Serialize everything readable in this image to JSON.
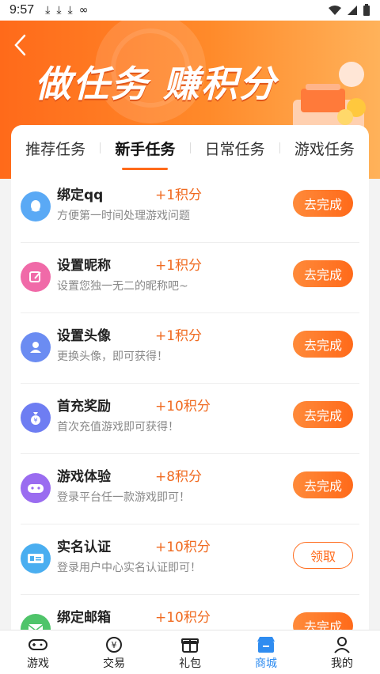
{
  "status_bar": {
    "time": "9:57"
  },
  "banner": {
    "title": "做任务 赚积分"
  },
  "tabs": [
    {
      "label": "推荐任务"
    },
    {
      "label": "新手任务"
    },
    {
      "label": "日常任务"
    },
    {
      "label": "游戏任务"
    }
  ],
  "active_tab": "新手任务",
  "tasks": [
    {
      "name": "绑定qq",
      "points": "+1积分",
      "desc": "方便第一时间处理游戏问题",
      "action": "去完成",
      "icon": "qq-icon",
      "color": "#5aa9f5"
    },
    {
      "name": "设置昵称",
      "points": "+1积分",
      "desc": "设置您独一无二的昵称吧~",
      "action": "去完成",
      "icon": "edit-icon",
      "color": "#f06aa8"
    },
    {
      "name": "设置头像",
      "points": "+1积分",
      "desc": "更换头像，即可获得！",
      "action": "去完成",
      "icon": "avatar-icon",
      "color": "#6b8cf2"
    },
    {
      "name": "首充奖励",
      "points": "+10积分",
      "desc": "首次充值游戏即可获得！",
      "action": "去完成",
      "icon": "money-bag-icon",
      "color": "#6e7df2"
    },
    {
      "name": "游戏体验",
      "points": "+8积分",
      "desc": "登录平台任一款游戏即可！",
      "action": "去完成",
      "icon": "gamepad-icon",
      "color": "#9a6cf0"
    },
    {
      "name": "实名认证",
      "points": "+10积分",
      "desc": "登录用户中心实名认证即可！",
      "action": "领取",
      "icon": "id-card-icon",
      "color": "#4aaef0"
    },
    {
      "name": "绑定邮箱",
      "points": "+10积分",
      "desc": "",
      "action": "去完成",
      "icon": "mail-icon",
      "color": "#4fc46a"
    }
  ],
  "bottom_nav": [
    {
      "label": "游戏",
      "icon": "gamepad-icon"
    },
    {
      "label": "交易",
      "icon": "trade-icon"
    },
    {
      "label": "礼包",
      "icon": "gift-icon"
    },
    {
      "label": "商城",
      "icon": "store-icon"
    },
    {
      "label": "我的",
      "icon": "user-icon"
    }
  ],
  "active_nav": "商城",
  "colors": {
    "accent": "#ff6a1a",
    "nav_active": "#2f8cf0"
  }
}
